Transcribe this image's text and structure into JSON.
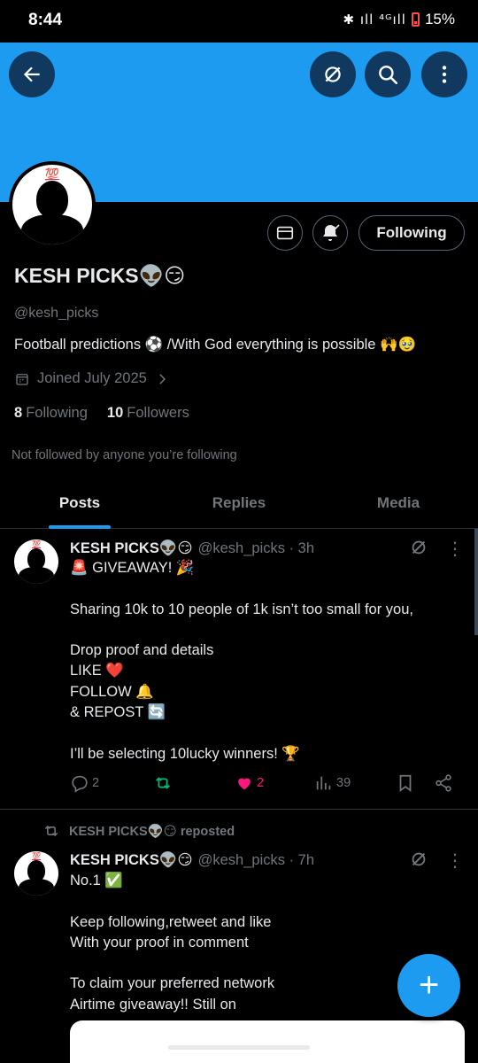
{
  "status_bar": {
    "time": "8:44",
    "signal": "✱ ıll ⁴ᴳıll",
    "battery": "15%"
  },
  "banner": {
    "back_icon": "arrow-left-icon",
    "grok_icon": "grok-icon",
    "search_icon": "search-icon",
    "more_icon": "more-vertical-icon",
    "color": "#1d9bf0"
  },
  "profile": {
    "avatar_badge": "💯",
    "name": "KESH PICKS👽😏",
    "handle": "@kesh_picks",
    "bio": "Football predictions ⚽ /With God everything is possible 🙌🥹",
    "joined": "Joined July 2025",
    "following_count": "8",
    "following_label": "Following",
    "followers_count": "10",
    "followers_label": "Followers",
    "not_followed": "Not followed by anyone you’re following",
    "following_button": "Following"
  },
  "tabs": [
    {
      "label": "Posts",
      "active": true
    },
    {
      "label": "Replies",
      "active": false
    },
    {
      "label": "Media",
      "active": false
    }
  ],
  "tweets": [
    {
      "name": "KESH PICKS👽😏",
      "handle_time": "@kesh_picks · 3h",
      "lines": [
        "🚨 GIVEAWAY! 🎉",
        "",
        "Sharing 10k to 10 people of 1k isn’t too small for you,",
        "",
        "Drop proof and details",
        "LIKE ❤️",
        "FOLLOW 🔔",
        "& REPOST 🔄",
        "",
        "I’ll be selecting 10lucky winners! 🏆"
      ],
      "actions": {
        "replies": "2",
        "retweets": "",
        "likes": "2",
        "views": "39"
      }
    },
    {
      "repost_label": "KESH PICKS👽😏 reposted",
      "name": "KESH PICKS👽😏",
      "handle_time": "@kesh_picks · 7h",
      "lines": [
        "No.1 ✅",
        "",
        "Keep following,retweet and like",
        "With your proof in comment",
        "",
        "To claim your preferred network",
        "Airtime giveaway!! Still on"
      ]
    }
  ],
  "fab_label": "+",
  "colors": {
    "accent": "#1d9bf0",
    "like": "#f91880",
    "retweet": "#00ba7c",
    "muted": "#71767b"
  }
}
